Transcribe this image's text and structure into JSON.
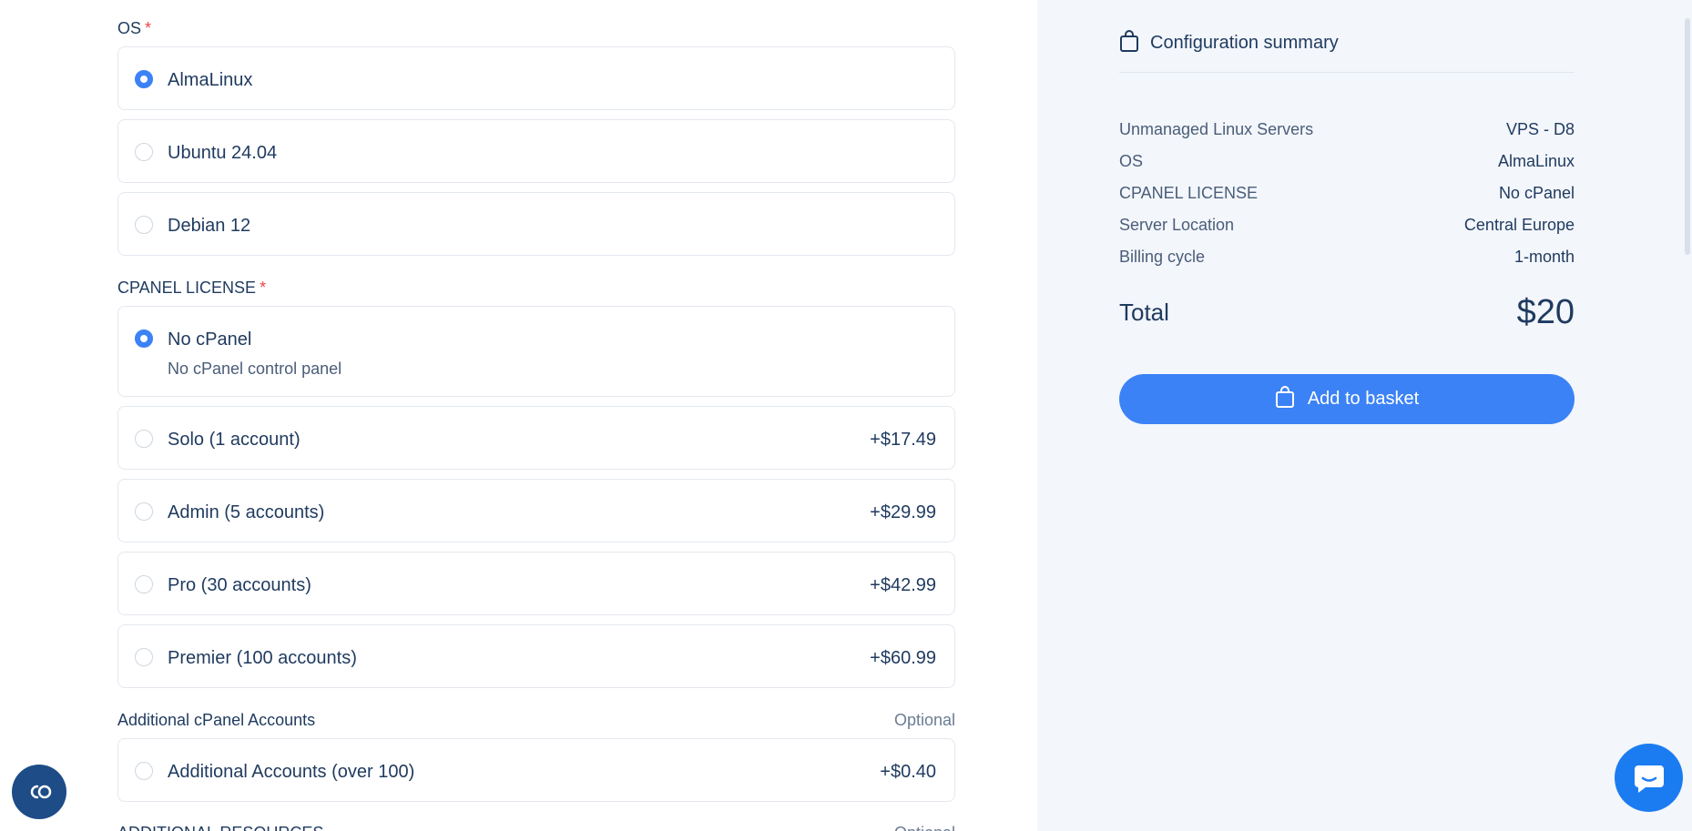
{
  "os": {
    "label": "OS",
    "required_mark": "*",
    "options": [
      {
        "title": "AlmaLinux",
        "checked": true
      },
      {
        "title": "Ubuntu 24.04",
        "checked": false
      },
      {
        "title": "Debian 12",
        "checked": false
      }
    ]
  },
  "cpanel": {
    "label": "CPANEL LICENSE",
    "required_mark": "*",
    "options": [
      {
        "title": "No cPanel",
        "desc": "No cPanel control panel",
        "checked": true
      },
      {
        "title": "Solo (1 account)",
        "price": "+$17.49",
        "checked": false
      },
      {
        "title": "Admin (5 accounts)",
        "price": "+$29.99",
        "checked": false
      },
      {
        "title": "Pro (30 accounts)",
        "price": "+$42.99",
        "checked": false
      },
      {
        "title": "Premier (100 accounts)",
        "price": "+$60.99",
        "checked": false
      }
    ]
  },
  "additional_accounts": {
    "label": "Additional cPanel Accounts",
    "optional": "Optional",
    "options": [
      {
        "title": "Additional Accounts (over 100)",
        "price": "+$0.40",
        "checked": false
      }
    ]
  },
  "additional_resources": {
    "label": "ADDITIONAL RESOURCES",
    "optional": "Optional"
  },
  "summary": {
    "title": "Configuration summary",
    "rows": [
      {
        "label": "Unmanaged Linux Servers",
        "value": "VPS - D8"
      },
      {
        "label": "OS",
        "value": "AlmaLinux"
      },
      {
        "label": "CPANEL LICENSE",
        "value": "No cPanel"
      },
      {
        "label": "Server Location",
        "value": "Central Europe"
      },
      {
        "label": "Billing cycle",
        "value": "1-month"
      }
    ],
    "total_label": "Total",
    "total_value": "$20",
    "add_button": "Add to basket"
  },
  "widgets": {
    "co_badge_icon": "co-icon",
    "chat_icon": "chat-bubble-icon"
  },
  "colors": {
    "accent": "#3b82f6",
    "text": "#1f3a5f",
    "panel_bg": "#f3f6fb"
  }
}
